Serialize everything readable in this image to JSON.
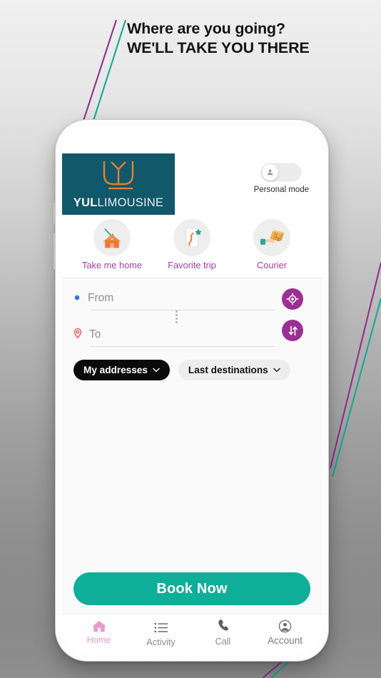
{
  "headline": {
    "line1": "Where are you going?",
    "line2": "WE'LL TAKE YOU THERE"
  },
  "app": {
    "logo": {
      "bold": "YUL",
      "light": "LIMOUSINE",
      "mark": "tulip-monogram"
    },
    "mode_toggle": {
      "label": "Personal mode",
      "state": "off",
      "icon": "person-icon"
    },
    "quick_actions": [
      {
        "label": "Take me home",
        "icon": "house-arrow-icon"
      },
      {
        "label": "Favorite trip",
        "icon": "map-star-icon"
      },
      {
        "label": "Courier",
        "icon": "hand-package-icon"
      }
    ],
    "route": {
      "from": {
        "placeholder": "From",
        "value": "",
        "icon": "blue-dot-icon"
      },
      "to": {
        "placeholder": "To",
        "value": "",
        "icon": "red-pin-icon"
      },
      "locate_button": "gps-target-icon",
      "swap_button": "swap-arrows-icon"
    },
    "chips": [
      {
        "label": "My addresses",
        "style": "dark",
        "icon": "chevron-down-icon"
      },
      {
        "label": "Last destinations",
        "style": "light",
        "icon": "chevron-down-icon"
      }
    ],
    "cta": {
      "label": "Book Now"
    },
    "nav": [
      {
        "label": "Home",
        "icon": "home-icon",
        "active": true
      },
      {
        "label": "Activity",
        "icon": "list-icon",
        "active": false
      },
      {
        "label": "Call",
        "icon": "phone-icon",
        "active": false
      },
      {
        "label": "Account",
        "icon": "account-circle-icon",
        "active": false
      }
    ]
  },
  "colors": {
    "brand_teal_dark": "#10586a",
    "brand_teal": "#0fae99",
    "brand_purple": "#9c2f93",
    "label_purple": "#a23f9c",
    "nav_active_pink": "#e69ec9",
    "accent_orange": "#f08032",
    "chip_dark": "#0b0b0b",
    "chip_light": "#ededed"
  }
}
